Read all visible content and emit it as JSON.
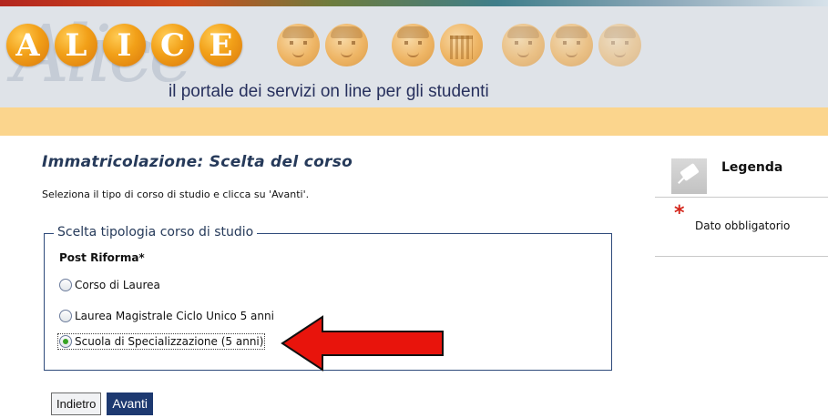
{
  "header": {
    "letters": [
      "A",
      "L",
      "I",
      "C",
      "E"
    ],
    "script_text": "Alice",
    "tagline": "il portale dei servizi on line per gli studenti",
    "colors": {
      "letter_circle": "#f2a018",
      "orange_bar": "#fbd58d",
      "header_bg": "#dfe3e8"
    }
  },
  "main": {
    "title": "Immatricolazione: Scelta del corso",
    "instructions": "Seleziona il tipo di corso di studio e clicca su 'Avanti'.",
    "fieldset": {
      "legend": "Scelta tipologia corso di studio",
      "section_label": "Post Riforma*",
      "options": [
        {
          "label": "Corso di Laurea",
          "selected": false
        },
        {
          "label": "Laurea Magistrale Ciclo Unico 5 anni",
          "selected": false
        },
        {
          "label": "Scuola di Specializzazione (5 anni)",
          "selected": true
        }
      ]
    },
    "buttons": {
      "back": "Indietro",
      "next": "Avanti"
    },
    "annotation_arrow": {
      "icon": "red-left-arrow-icon",
      "color": "#e8140c"
    }
  },
  "legend_panel": {
    "title": "Legenda",
    "required_symbol": "*",
    "required_text": "Dato obbligatorio"
  }
}
